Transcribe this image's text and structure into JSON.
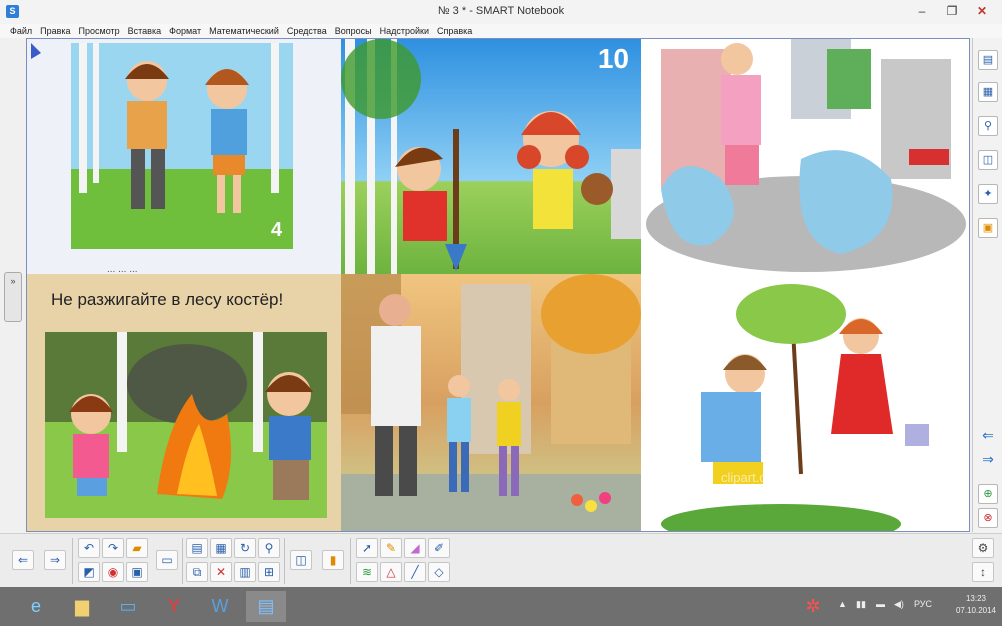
{
  "window": {
    "title": "№ 3 * - SMART Notebook",
    "minimize": "–",
    "maximize": "❐",
    "close": "✕"
  },
  "menu": [
    "Файл",
    "Правка",
    "Просмотр",
    "Вставка",
    "Формат",
    "Математический",
    "Средства",
    "Вопросы",
    "Надстройки",
    "Справка"
  ],
  "canvas": {
    "page_number": "10",
    "card1_number": "4",
    "card1_partial_text": "... ... ...",
    "fire_caption": "Не разжигайте в лесу костёр!",
    "clipart_watermark": "clipart.com"
  },
  "left_handle": {
    "label": "»"
  },
  "sidebar": {
    "buttons": [
      "page-sorter",
      "gallery",
      "attachments",
      "properties",
      "add-ons",
      "smart-response"
    ],
    "prev_arrow": "⇐",
    "next_arrow": "⇒"
  },
  "toolbar": {
    "back": "⇐",
    "forward": "⇒",
    "undo": "↶",
    "redo": "↷"
  },
  "taskbar": {
    "clock_time": "13:23",
    "clock_date": "07.10.2014",
    "lang": "РУС"
  },
  "colors": {
    "canvas_border": "#7b8fbf",
    "accent": "#2a73c7",
    "taskbar": "#6f6f6f"
  }
}
